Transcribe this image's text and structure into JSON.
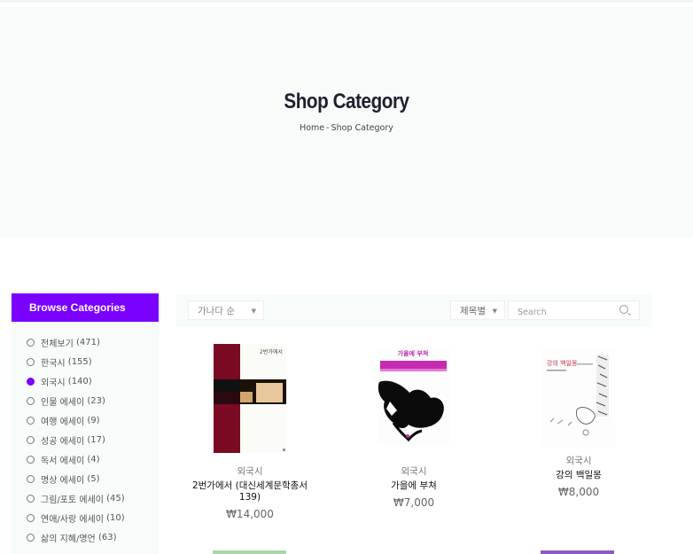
{
  "hero": {
    "title": "Shop Category",
    "breadcrumb_home": "Home",
    "breadcrumb_sep": "-",
    "breadcrumb_current": "Shop Category"
  },
  "sidebar": {
    "heading": "Browse Categories",
    "items": [
      {
        "label": "전체보기",
        "count": "(471)",
        "selected": false
      },
      {
        "label": "한국시",
        "count": "(155)",
        "selected": false
      },
      {
        "label": "외국시",
        "count": "(140)",
        "selected": true
      },
      {
        "label": "인물 에세이",
        "count": "(23)",
        "selected": false
      },
      {
        "label": "여행 에세이",
        "count": "(9)",
        "selected": false
      },
      {
        "label": "성공 에세이",
        "count": "(17)",
        "selected": false
      },
      {
        "label": "독서 에세이",
        "count": "(4)",
        "selected": false
      },
      {
        "label": "명상 에세이",
        "count": "(5)",
        "selected": false
      },
      {
        "label": "그림/포토 에세이",
        "count": "(45)",
        "selected": false
      },
      {
        "label": "연애/사랑 에세이",
        "count": "(10)",
        "selected": false
      },
      {
        "label": "삶의 지혜/명언",
        "count": "(63)",
        "selected": false
      }
    ]
  },
  "toolbar": {
    "sort_value": "가나다 순",
    "filter_value": "제목별",
    "search_placeholder": "Search"
  },
  "products": [
    {
      "category": "외국시",
      "title_line1": "2번가에서 (대신세계문학총서",
      "title_line2": "139)",
      "price": "₩14,000",
      "cover_text": "2번가에서"
    },
    {
      "category": "외국시",
      "title_line1": "가을에 부쳐",
      "title_line2": "",
      "price": "₩7,000",
      "cover_text": "가을에 부쳐"
    },
    {
      "category": "외국시",
      "title_line1": "강의 백일몽",
      "title_line2": "",
      "price": "₩8,000",
      "cover_text": "강의 백일몽"
    }
  ],
  "colors": {
    "accent": "#7a00ff",
    "hero_bg": "#f7fcfa"
  }
}
